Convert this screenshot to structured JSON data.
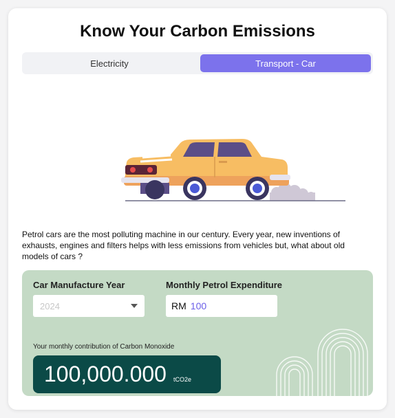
{
  "title": "Know Your Carbon Emissions",
  "tabs": [
    {
      "label": "Electricity",
      "active": false
    },
    {
      "label": "Transport - Car",
      "active": true
    }
  ],
  "description": "Petrol cars are the most polluting machine in our century. Every year, new inventions of exhausts, engines and filters helps with less emissions from vehicles but, what about old models of cars ?",
  "form": {
    "year_label": "Car Manufacture Year",
    "year_value": "2024",
    "expenditure_label": "Monthly Petrol Expenditure",
    "expenditure_prefix": "RM",
    "expenditure_value": "100"
  },
  "result": {
    "label": "Your monthly contribution of Carbon Monoxide",
    "value": "100,000.000",
    "unit": "tCO2e"
  },
  "colors": {
    "accent": "#7c72ec",
    "panel": "#c4dac5",
    "result_bg": "#0b4a47",
    "car_body": "#f7bd63"
  },
  "icons": {
    "dropdown": "chevron-down-icon",
    "illustration": "car-illustration"
  }
}
